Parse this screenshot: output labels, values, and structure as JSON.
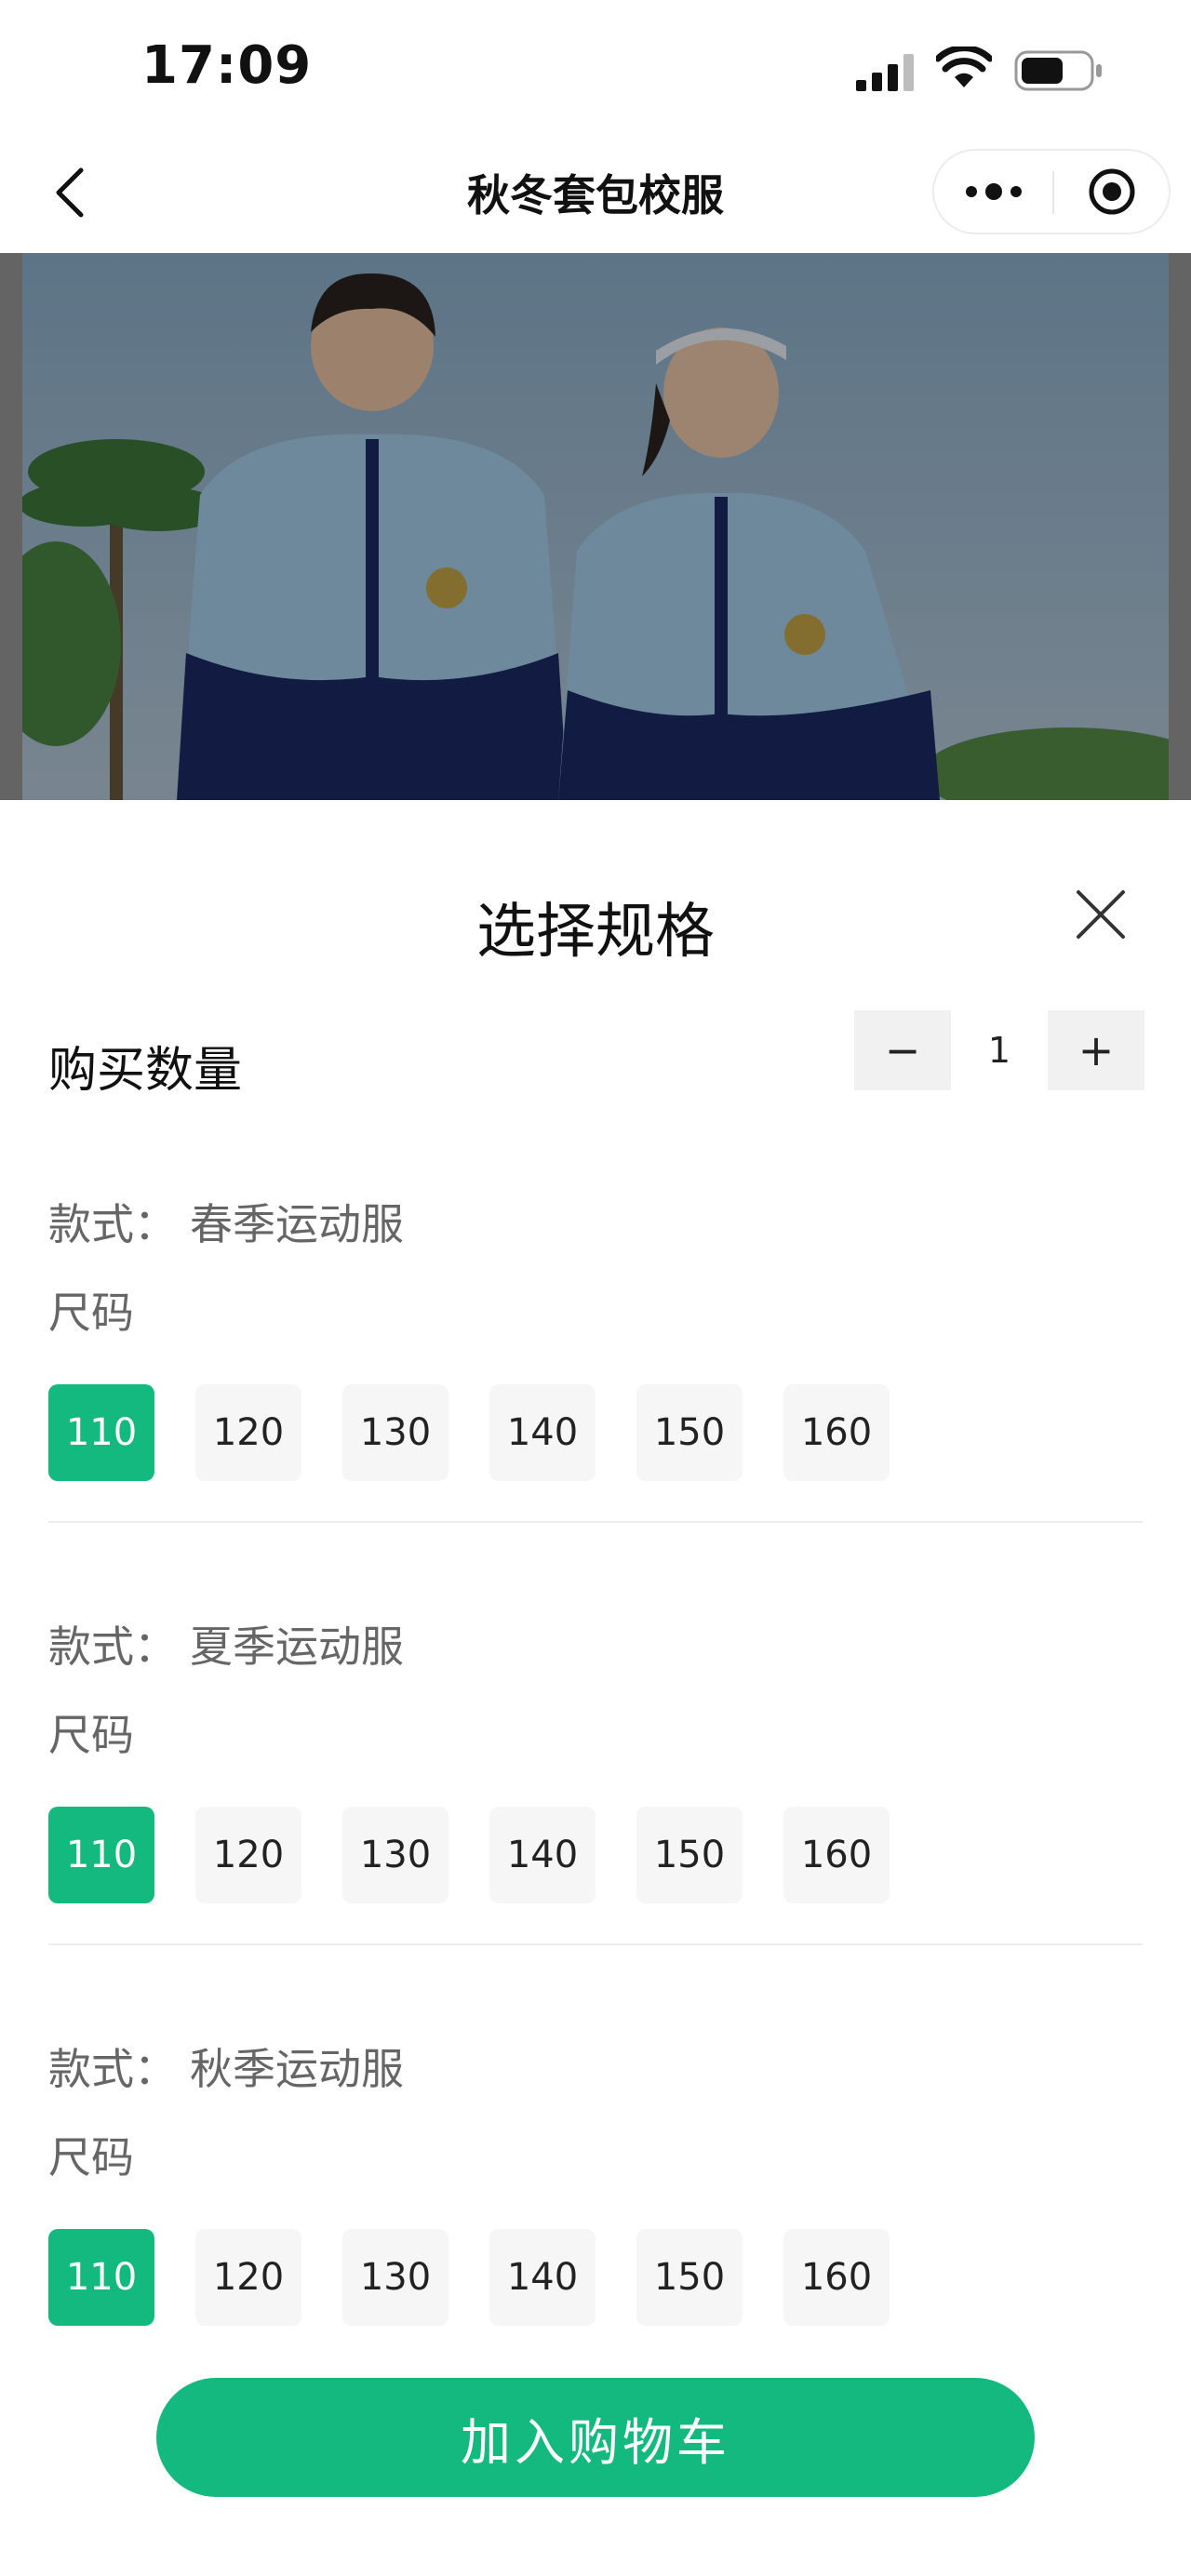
{
  "status_bar": {
    "time": "17:09"
  },
  "nav": {
    "title": "秋冬套包校服"
  },
  "sheet": {
    "title": "选择规格",
    "quantity_label": "购买数量",
    "quantity": "1",
    "minus": "−",
    "plus": "+",
    "style_prefix": "款式：",
    "size_label": "尺码",
    "groups": [
      {
        "style": "春季运动服",
        "sizes": [
          "110",
          "120",
          "130",
          "140",
          "150",
          "160"
        ],
        "selected": "110"
      },
      {
        "style": "夏季运动服",
        "sizes": [
          "110",
          "120",
          "130",
          "140",
          "150",
          "160"
        ],
        "selected": "110"
      },
      {
        "style": "秋季运动服",
        "sizes": [
          "110",
          "120",
          "130",
          "140",
          "150",
          "160"
        ],
        "selected": "110"
      }
    ]
  },
  "cart_button": "加入购物车",
  "colors": {
    "accent": "#14b97f",
    "chip_bg": "#f6f6f6",
    "overlay": "rgba(0,0,0,0.35)"
  },
  "icons": [
    "back-icon",
    "more-dots-icon",
    "target-icon",
    "close-icon",
    "signal-icon",
    "wifi-icon",
    "battery-icon"
  ]
}
